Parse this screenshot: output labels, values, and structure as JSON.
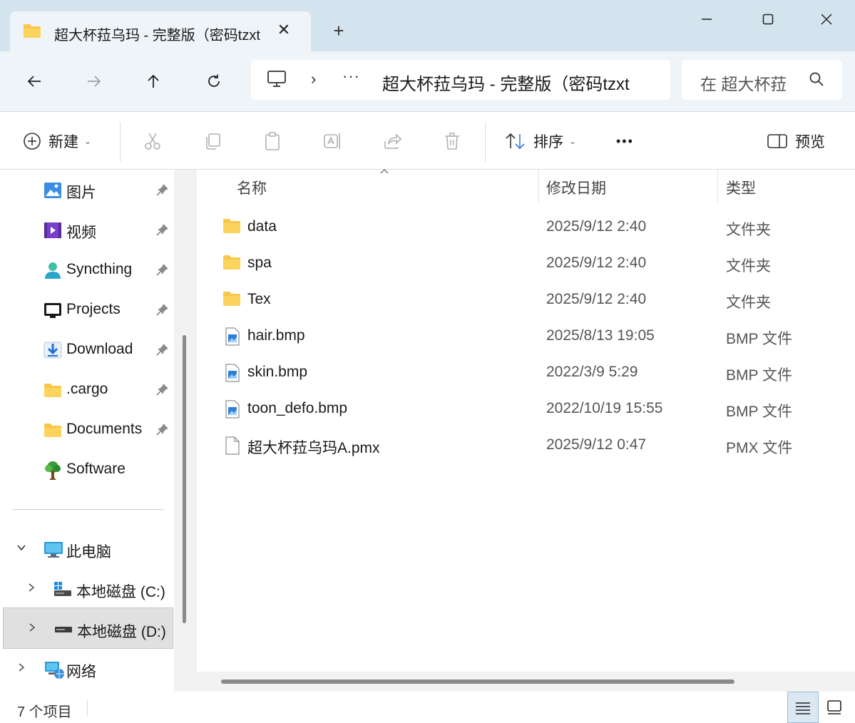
{
  "window": {
    "tab_title": "超大杯菈乌玛 - 完整版（密码tzxt",
    "new_tab": "+"
  },
  "address": {
    "chevron": "›",
    "more": "···",
    "path": "超大杯菈乌玛 - 完整版（密码tzxt",
    "search_placeholder": "在 超大杯菈"
  },
  "toolbar": {
    "new_label": "新建",
    "sort_label": "排序",
    "more_label": "•••",
    "preview_label": "预览",
    "caret": "⌄"
  },
  "sidebar": {
    "quick_access": [
      {
        "label": "图片",
        "icon": "pictures-icon"
      },
      {
        "label": "视频",
        "icon": "videos-icon"
      },
      {
        "label": "Syncthing",
        "icon": "user-icon"
      },
      {
        "label": "Projects",
        "icon": "monitor-icon"
      },
      {
        "label": "Download",
        "icon": "download-icon"
      },
      {
        "label": ".cargo",
        "icon": "folder-icon"
      },
      {
        "label": "Documents",
        "icon": "folder-icon"
      },
      {
        "label": "Software",
        "icon": "tree-icon"
      }
    ],
    "this_pc": "此电脑",
    "drive_c": "本地磁盘 (C:)",
    "drive_d": "本地磁盘 (D:)",
    "network": "网络"
  },
  "columns": {
    "name": "名称",
    "modified": "修改日期",
    "type": "类型"
  },
  "files": [
    {
      "name": "data",
      "date": "2025/9/12 2:40",
      "type": "文件夹",
      "kind": "folder"
    },
    {
      "name": "spa",
      "date": "2025/9/12 2:40",
      "type": "文件夹",
      "kind": "folder"
    },
    {
      "name": "Tex",
      "date": "2025/9/12 2:40",
      "type": "文件夹",
      "kind": "folder"
    },
    {
      "name": "hair.bmp",
      "date": "2025/8/13 19:05",
      "type": "BMP 文件",
      "kind": "image"
    },
    {
      "name": "skin.bmp",
      "date": "2022/3/9 5:29",
      "type": "BMP 文件",
      "kind": "image"
    },
    {
      "name": "toon_defo.bmp",
      "date": "2022/10/19 15:55",
      "type": "BMP 文件",
      "kind": "image"
    },
    {
      "name": "超大杯菈乌玛A.pmx",
      "date": "2025/9/12 0:47",
      "type": "PMX 文件",
      "kind": "file"
    }
  ],
  "status": {
    "count": "7 个项目"
  },
  "colors": {
    "titlebar": "#d4e4ee",
    "addressbar": "#eef4f8",
    "folder": "#f8c74a",
    "accent": "#2f7fd6"
  }
}
